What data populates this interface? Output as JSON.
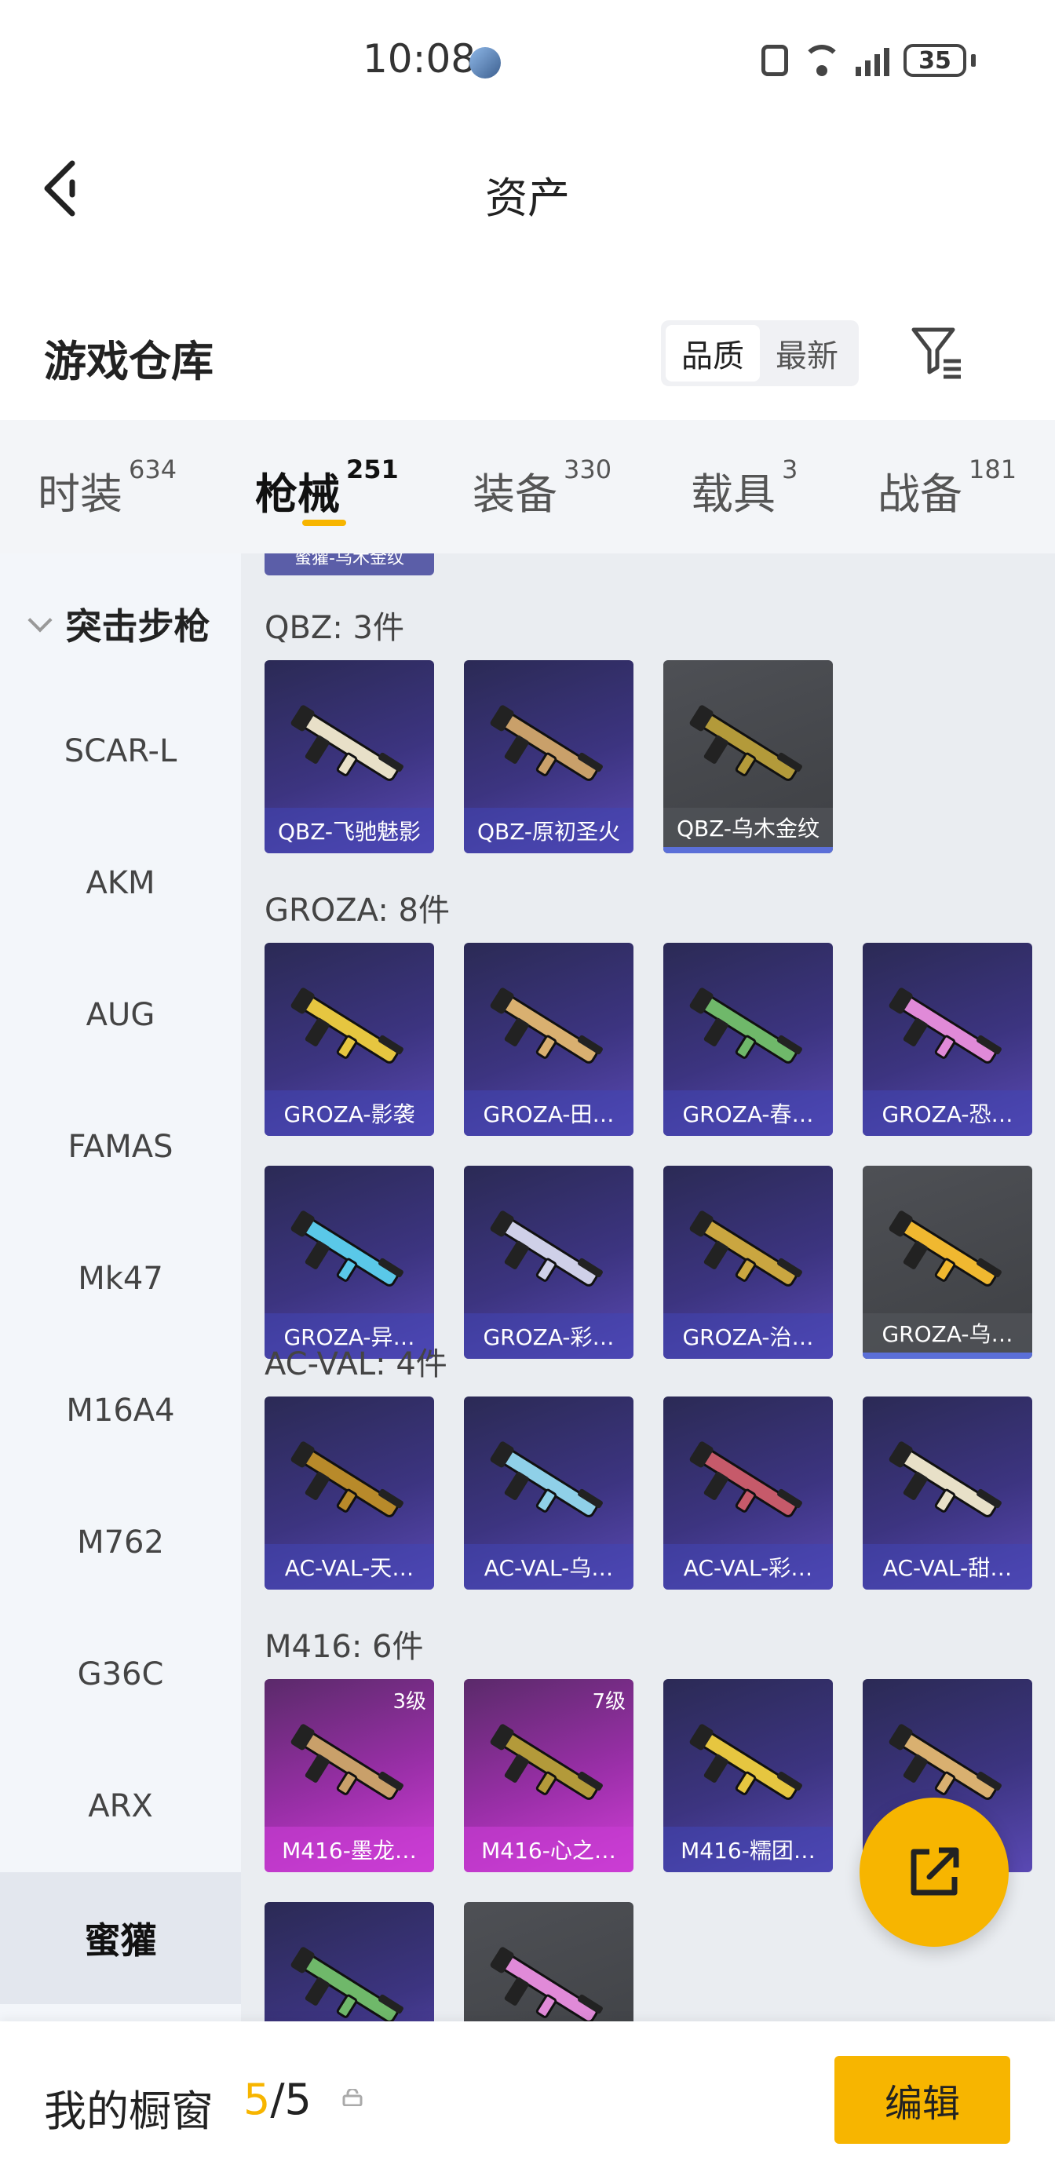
{
  "status_bar": {
    "time": "10:08",
    "battery": "35"
  },
  "header": {
    "title": "资产"
  },
  "warehouse": {
    "title": "游戏仓库",
    "sort_options": [
      {
        "label": "品质",
        "active": true
      },
      {
        "label": "最新",
        "active": false
      }
    ]
  },
  "tabs": [
    {
      "label": "时装",
      "count": "634",
      "active": false
    },
    {
      "label": "枪械",
      "count": "251",
      "active": true
    },
    {
      "label": "装备",
      "count": "330",
      "active": false
    },
    {
      "label": "载具",
      "count": "3",
      "active": false
    },
    {
      "label": "战备",
      "count": "181",
      "active": false
    }
  ],
  "sidebar": {
    "category": "突击步枪",
    "items": [
      "SCAR-L",
      "AKM",
      "AUG",
      "FAMAS",
      "Mk47",
      "M16A4",
      "M762",
      "G36C",
      "ARX",
      "蜜獾"
    ],
    "active_index": 9
  },
  "content": {
    "partial_top_label": "蜜獾-乌木金纹",
    "groups": [
      {
        "title": "QBZ: 3件",
        "items": [
          {
            "name": "QBZ-飞驰魅影",
            "style": "purple"
          },
          {
            "name": "QBZ-原初圣火",
            "style": "purple"
          },
          {
            "name": "QBZ-乌木金纹",
            "style": "gray"
          }
        ]
      },
      {
        "title": "GROZA: 8件",
        "items": [
          {
            "name": "GROZA-影袭",
            "style": "purple"
          },
          {
            "name": "GROZA-田…",
            "style": "purple"
          },
          {
            "name": "GROZA-春…",
            "style": "purple"
          },
          {
            "name": "GROZA-恐…",
            "style": "purple"
          },
          {
            "name": "GROZA-异…",
            "style": "purple"
          },
          {
            "name": "GROZA-彩…",
            "style": "purple"
          },
          {
            "name": "GROZA-治…",
            "style": "purple"
          },
          {
            "name": "GROZA-乌…",
            "style": "gray"
          }
        ]
      },
      {
        "title": "AC-VAL: 4件",
        "items": [
          {
            "name": "AC-VAL-天…",
            "style": "purple"
          },
          {
            "name": "AC-VAL-乌…",
            "style": "purple"
          },
          {
            "name": "AC-VAL-彩…",
            "style": "purple"
          },
          {
            "name": "AC-VAL-甜…",
            "style": "purple"
          }
        ]
      },
      {
        "title": "M416: 6件",
        "items": [
          {
            "name": "M416-墨龙…",
            "style": "pink",
            "level": "3级"
          },
          {
            "name": "M416-心之…",
            "style": "pink",
            "level": "7级"
          },
          {
            "name": "M416-糯团…",
            "style": "purple"
          },
          {
            "name": "",
            "style": "purple"
          },
          {
            "name": "",
            "style": "purple"
          },
          {
            "name": "",
            "style": "gray"
          }
        ]
      }
    ]
  },
  "bottom_bar": {
    "label": "我的橱窗",
    "current": "5",
    "total": "/5",
    "edit_label": "编辑"
  },
  "colors": {
    "accent": "#f7b500",
    "card_purple": "#3c3480",
    "card_pink": "#d23ed8"
  },
  "icons": {
    "back": "back-arrow-icon",
    "filter": "filter-icon",
    "share": "share-icon",
    "lock": "lock-icon"
  }
}
